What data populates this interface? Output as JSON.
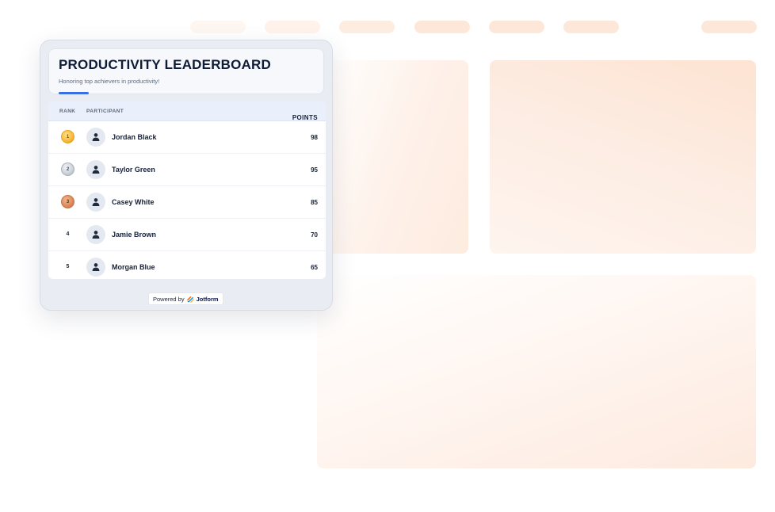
{
  "leaderboard": {
    "title": "PRODUCTIVITY LEADERBOARD",
    "subtitle": "Honoring top achievers in productivity!",
    "columns": {
      "rank": "RANK",
      "participant": "PARTICIPANT",
      "points": "POINTS"
    },
    "rows": [
      {
        "rank": "1",
        "badge": "gold-medal-icon",
        "name": "Jordan Black",
        "points": "98"
      },
      {
        "rank": "2",
        "badge": "silver-medal-icon",
        "name": "Taylor Green",
        "points": "95"
      },
      {
        "rank": "3",
        "badge": "bronze-medal-icon",
        "name": "Casey White",
        "points": "85"
      },
      {
        "rank": "4",
        "badge": null,
        "name": "Jamie Brown",
        "points": "70"
      },
      {
        "rank": "5",
        "badge": null,
        "name": "Morgan Blue",
        "points": "65"
      }
    ],
    "footer": {
      "prefix": "Powered by",
      "brand": "Jotform",
      "icon": "jotform-logo-icon"
    }
  },
  "colors": {
    "accent": "#3a6fe0",
    "title": "#0d1b36",
    "background_tint": "#fde7d8",
    "gold": "#f5b93a",
    "silver": "#c9d0d8",
    "bronze": "#d9895a"
  }
}
